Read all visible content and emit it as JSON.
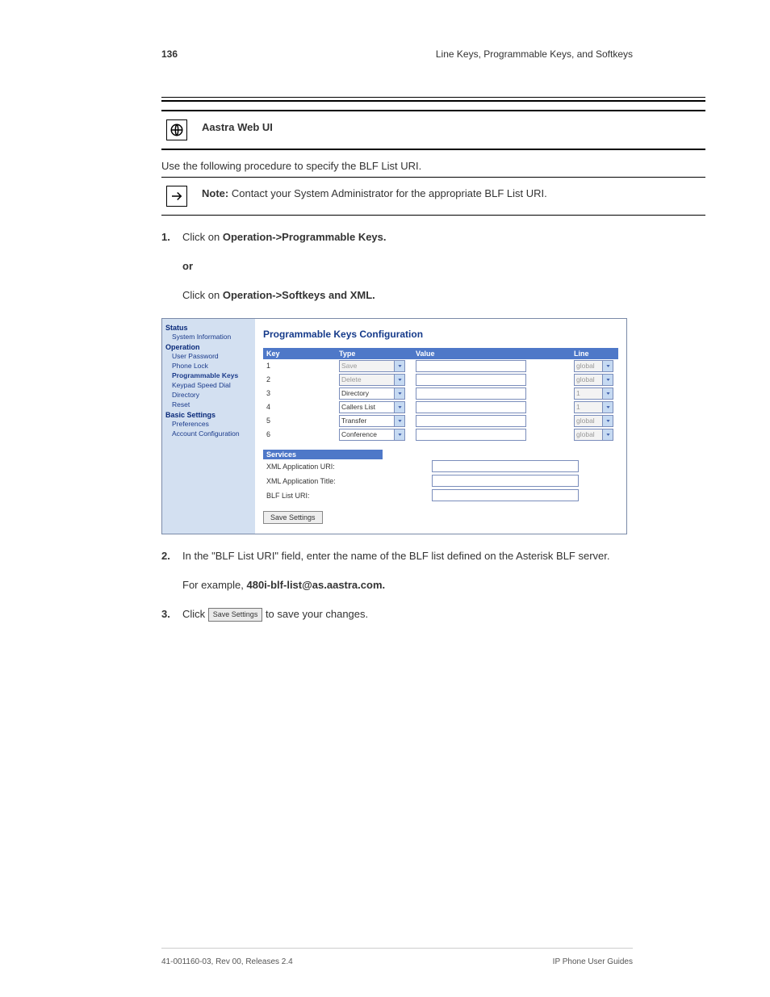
{
  "header": {
    "page_number": "136",
    "section_title": "Line Keys, Programmable Keys, and Softkeys"
  },
  "webui_callout": {
    "heading": "Aastra Web UI"
  },
  "note_callout": {
    "prefix": "Note:",
    "text": "Contact your System Administrator for the appropriate BLF List URI."
  },
  "instruction_intro": "Use the following procedure to specify the BLF List URI.",
  "steps": [
    {
      "num": "1.",
      "body_prefix": "Click on ",
      "bold": "Operation->Programmable Keys.",
      "body_suffix": ""
    },
    {
      "num": "or",
      "is_or": true
    },
    {
      "num": "",
      "body_prefix": "Click on ",
      "bold": "Operation->Softkeys and XML.",
      "body_suffix": ""
    }
  ],
  "app": {
    "nav": {
      "status_h": "Status",
      "system_info": "System Information",
      "operation_h": "Operation",
      "user_password": "User Password",
      "phone_lock": "Phone Lock",
      "programmable_keys": "Programmable Keys",
      "keypad_speed_dial": "Keypad Speed Dial",
      "directory": "Directory",
      "reset": "Reset",
      "basic_h": "Basic Settings",
      "preferences": "Preferences",
      "account_configuration": "Account Configuration"
    },
    "main": {
      "title": "Programmable Keys Configuration",
      "cols": {
        "key": "Key",
        "type": "Type",
        "value": "Value",
        "line": "Line"
      },
      "rows": [
        {
          "key": "1",
          "type": "Save",
          "type_disabled": true,
          "line": "global",
          "line_disabled": true
        },
        {
          "key": "2",
          "type": "Delete",
          "type_disabled": true,
          "line": "global",
          "line_disabled": true
        },
        {
          "key": "3",
          "type": "Directory",
          "type_disabled": false,
          "line": "1",
          "line_disabled": true
        },
        {
          "key": "4",
          "type": "Callers List",
          "type_disabled": false,
          "line": "1",
          "line_disabled": true
        },
        {
          "key": "5",
          "type": "Transfer",
          "type_disabled": false,
          "line": "global",
          "line_disabled": true
        },
        {
          "key": "6",
          "type": "Conference",
          "type_disabled": false,
          "line": "global",
          "line_disabled": true
        }
      ],
      "services_h": "Services",
      "svc1": "XML Application URI:",
      "svc2": "XML Application Title:",
      "svc3": "BLF List URI:",
      "save_settings": "Save Settings"
    }
  },
  "after_steps": [
    {
      "num": "2.",
      "parts": [
        "In the \"BLF List URI\" field, enter the name of the BLF list defined on the Asterisk BLF server."
      ]
    },
    {
      "num": "",
      "parts": [
        "For example, ",
        {
          "bold": "480i-blf-list@as.aastra.com."
        }
      ]
    },
    {
      "num": "3.",
      "parts": [
        "Click ",
        {
          "img_btn": "Save Settings"
        },
        " to save your changes."
      ]
    }
  ],
  "footer": {
    "doc_id": "41-001160-03, Rev 00, Releases 2.4",
    "doc_title": "IP Phone User Guides"
  }
}
